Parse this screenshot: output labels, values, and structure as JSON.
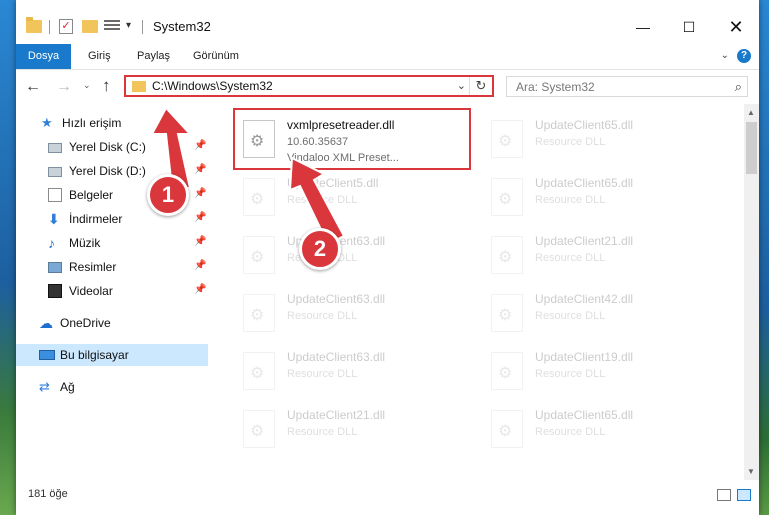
{
  "window": {
    "title": "System32",
    "min": "—",
    "max": "☐",
    "close": "✕"
  },
  "ribbon": {
    "tabs": [
      "Dosya",
      "Giriş",
      "Paylaş",
      "Görünüm"
    ],
    "expand": "⌄",
    "help": "?"
  },
  "nav": {
    "back": "←",
    "forward": "→",
    "recent": "⌄",
    "up": "↑",
    "address": "C:\\Windows\\System32",
    "address_drop": "⌄",
    "refresh": "↻",
    "search_placeholder": "Ara: System32",
    "search_glyph": "⌕"
  },
  "sidebar": {
    "items": [
      {
        "label": "Hızlı erişim",
        "pin": ""
      },
      {
        "label": "Yerel Disk (C:)",
        "pin": "📌"
      },
      {
        "label": "Yerel Disk (D:)",
        "pin": "📌"
      },
      {
        "label": "Belgeler",
        "pin": "📌"
      },
      {
        "label": "İndirmeler",
        "pin": "📌"
      },
      {
        "label": "Müzik",
        "pin": "📌"
      },
      {
        "label": "Resimler",
        "pin": "📌"
      },
      {
        "label": "Videolar",
        "pin": "📌"
      },
      {
        "label": "OneDrive",
        "pin": ""
      },
      {
        "label": "Bu bilgisayar",
        "pin": ""
      },
      {
        "label": "Ağ",
        "pin": ""
      }
    ],
    "glyphs": {
      "star": "★",
      "down": "⬇",
      "music": "♪",
      "cloud": "☁",
      "net": "⇄"
    }
  },
  "files": [
    {
      "name": "vxmlpresetreader.dll",
      "line2": "10.60.35637",
      "line3": "Vindaloo XML Preset..."
    },
    {
      "name": "UpdateClient65.dll",
      "line2": "Resource DLL",
      "line3": ""
    },
    {
      "name": "UpdateClient5.dll",
      "line2": "Resource DLL",
      "line3": ""
    },
    {
      "name": "UpdateClient65.dll",
      "line2": "Resource DLL",
      "line3": ""
    },
    {
      "name": "UpdateClient63.dll",
      "line2": "Resource DLL",
      "line3": ""
    },
    {
      "name": "UpdateClient21.dll",
      "line2": "Resource DLL",
      "line3": ""
    },
    {
      "name": "UpdateClient63.dll",
      "line2": "Resource DLL",
      "line3": ""
    },
    {
      "name": "UpdateClient42.dll",
      "line2": "Resource DLL",
      "line3": ""
    },
    {
      "name": "UpdateClient63.dll",
      "line2": "Resource DLL",
      "line3": ""
    },
    {
      "name": "UpdateClient19.dll",
      "line2": "Resource DLL",
      "line3": ""
    },
    {
      "name": "UpdateClient21.dll",
      "line2": "Resource DLL",
      "line3": ""
    },
    {
      "name": "UpdateClient65.dll",
      "line2": "Resource DLL",
      "line3": ""
    }
  ],
  "status": {
    "count": "181 öğe"
  },
  "annotations": {
    "badge1": "1",
    "badge2": "2"
  },
  "colors": {
    "accent": "#1979ca",
    "highlight": "#d9373b",
    "selected": "#cce8ff"
  }
}
